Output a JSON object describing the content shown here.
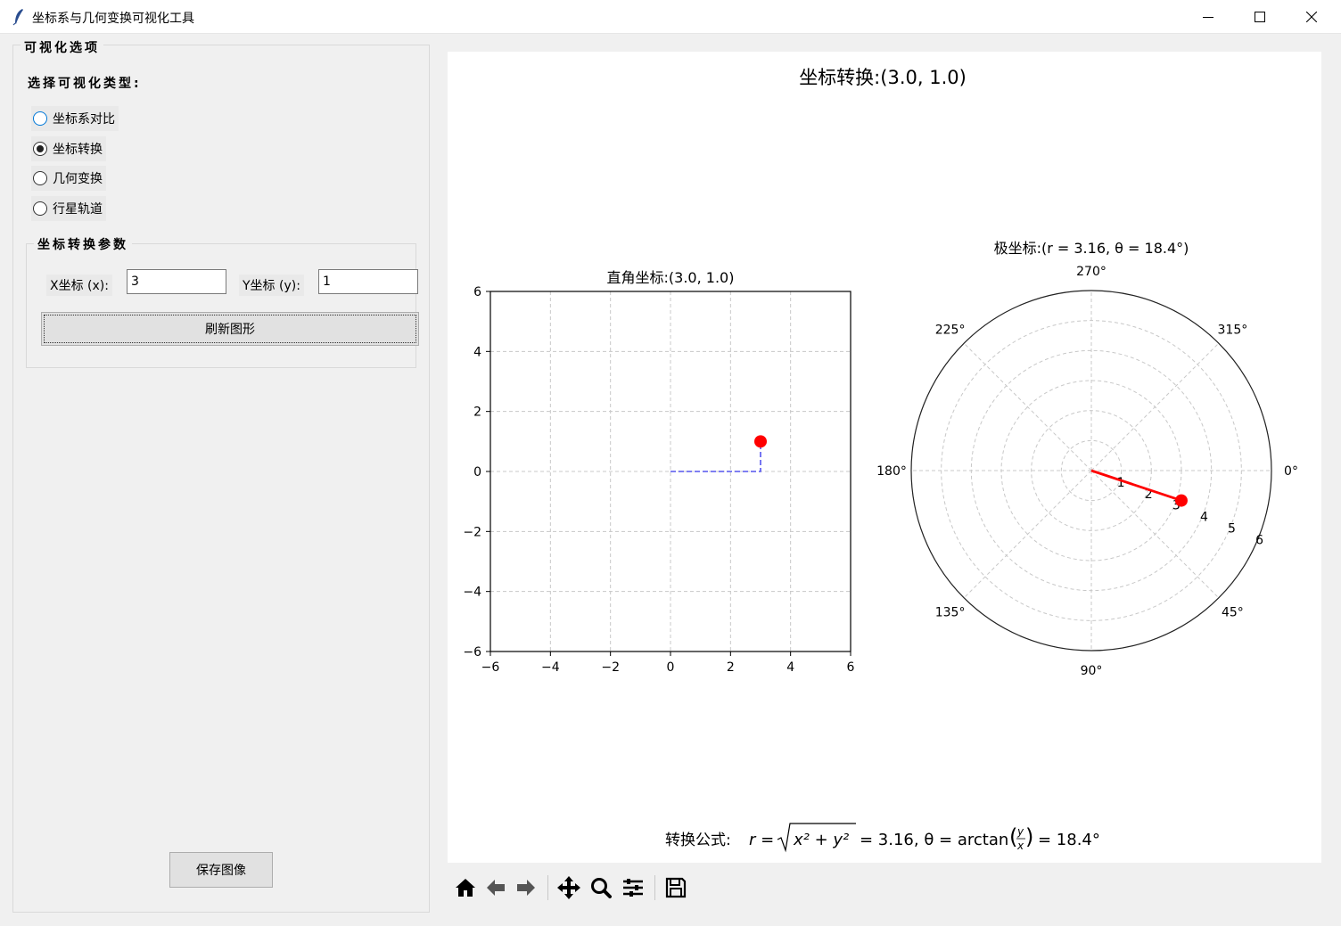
{
  "window": {
    "title": "坐标系与几何变换可视化工具"
  },
  "sidebar": {
    "frame_title": "可视化选项",
    "type_label": "选择可视化类型:",
    "options": [
      {
        "label": "坐标系对比",
        "selected": false
      },
      {
        "label": "坐标转换",
        "selected": true
      },
      {
        "label": "几何变换",
        "selected": false
      },
      {
        "label": "行星轨道",
        "selected": false
      }
    ],
    "params": {
      "frame_title": "坐标转换参数",
      "x_label": "X坐标 (x):",
      "x_value": "3",
      "y_label": "Y坐标 (y):",
      "y_value": "1",
      "refresh_label": "刷新图形"
    },
    "save_label": "保存图像"
  },
  "figure": {
    "suptitle": "坐标转换:(3.0, 1.0)",
    "formula_prefix": "转换公式:",
    "formula_r": "r = ",
    "formula_sqrt": "x² + y²",
    "formula_rest": "= 3.16, θ = arctan",
    "formula_frac_num": "y",
    "formula_frac_den": "x",
    "formula_end": "= 18.4°",
    "colors": {
      "point": "#ff0000",
      "projection": "#5555ee",
      "grid": "#c8c8c8"
    }
  },
  "chart_data": [
    {
      "type": "scatter",
      "title": "直角坐标:(3.0, 1.0)",
      "x": [
        3.0
      ],
      "y": [
        1.0
      ],
      "xlim": [
        -6,
        6
      ],
      "ylim": [
        -6,
        6
      ],
      "xticks": [
        "−6",
        "−4",
        "−2",
        "0",
        "2",
        "4",
        "6"
      ],
      "yticks": [
        "6",
        "4",
        "2",
        "0",
        "−2",
        "−4",
        "−6"
      ],
      "tick_values": [
        -6,
        -4,
        -2,
        0,
        2,
        4,
        6
      ],
      "grid": true,
      "projection_lines": true
    },
    {
      "type": "polar",
      "title": "极坐标:(r = 3.16, θ = 18.4°)",
      "r": [
        3.16
      ],
      "theta_deg": [
        18.4
      ],
      "rlim": [
        0,
        6
      ],
      "r_tick_values": [
        1,
        2,
        3,
        4,
        5,
        6
      ],
      "r_ticks": [
        "1",
        "2",
        "3",
        "4",
        "5",
        "6"
      ],
      "theta_tick_values": [
        0,
        45,
        90,
        135,
        180,
        225,
        270,
        315
      ],
      "theta_ticks": [
        "0°",
        "45°",
        "90°",
        "135°",
        "180°",
        "225°",
        "270°",
        "315°"
      ],
      "theta_direction": "clockwise",
      "grid": true
    }
  ]
}
